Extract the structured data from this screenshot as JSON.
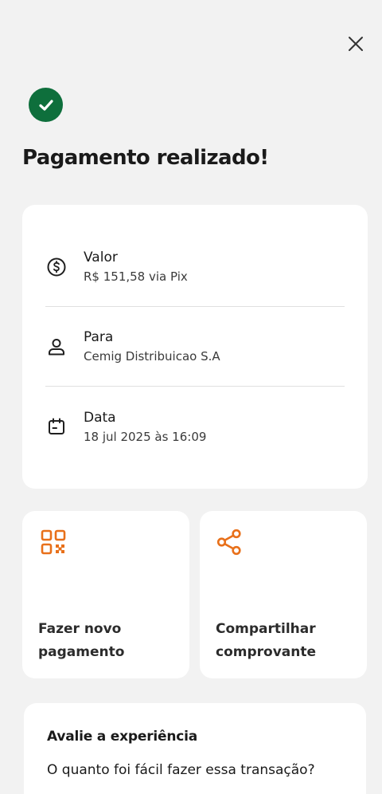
{
  "header": {
    "title": "Pagamento realizado!"
  },
  "icons": {
    "close": "close-icon",
    "success": "check-circle-icon",
    "valor": "dollar-circle-icon",
    "para": "person-icon",
    "data": "calendar-icon",
    "novo_pagamento": "qr-code-icon",
    "compartilhar": "share-icon"
  },
  "colors": {
    "success": "#0e6f3c",
    "accent": "#e8701a",
    "background": "#f2f2f2",
    "card": "#ffffff"
  },
  "details": {
    "valor": {
      "label": "Valor",
      "value": "R$ 151,58 via Pix"
    },
    "para": {
      "label": "Para",
      "value": "Cemig Distribuicao S.A"
    },
    "data": {
      "label": "Data",
      "value": "18 jul 2025 às 16:09"
    }
  },
  "actions": {
    "novo_pagamento": "Fazer novo pagamento",
    "compartilhar": "Compartilhar comprovante"
  },
  "rating": {
    "title": "Avalie a experiência",
    "question": "O quanto foi fácil fazer essa transação?"
  }
}
